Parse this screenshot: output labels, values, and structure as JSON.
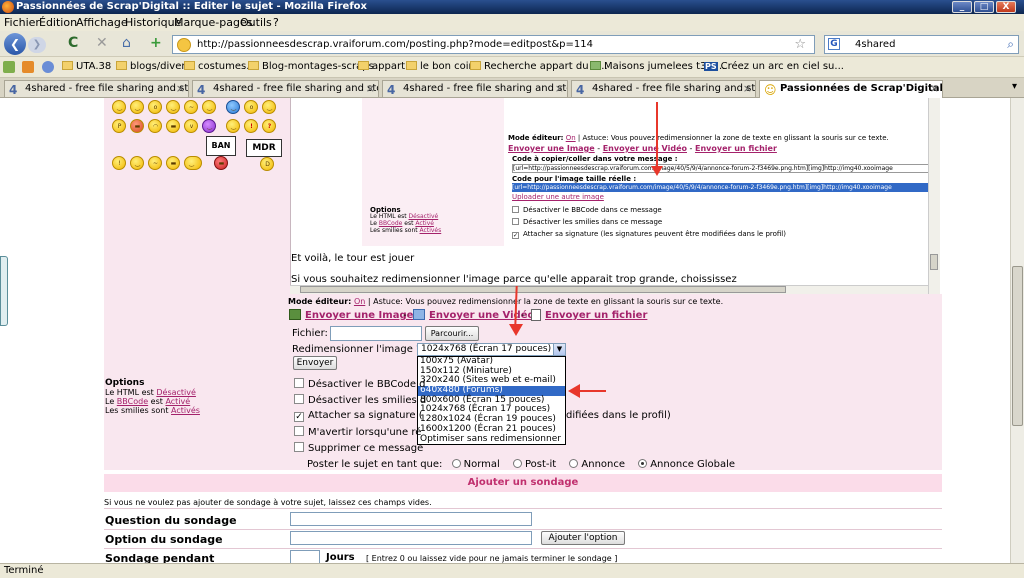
{
  "window": {
    "title": "Passionnées de Scrap'Digital :: Editer le sujet - Mozilla Firefox",
    "min": "_",
    "max": "□",
    "close": "X"
  },
  "menu": [
    "Fichier",
    "Édition",
    "Affichage",
    "Historique",
    "Marque-pages",
    "Outils",
    "?"
  ],
  "nav": {
    "url": "http://passionneesdescrap.vraiforum.com/posting.php?mode=editpost&p=114",
    "search": "4shared",
    "search_engine": "G",
    "back_glyph": "❮",
    "forward_glyph": "❯",
    "reload_glyph": "C",
    "stop_glyph": "✕",
    "home_glyph": "⌂",
    "add_glyph": "+",
    "star_glyph": "☆",
    "go_glyph": "⌕"
  },
  "bookmarks": [
    "UTA.38",
    "blogs/divers",
    "costumes...",
    "Blog-montages-scraps",
    "appart",
    "le bon coin",
    "Recherche appart du 2...",
    "Maisons jumelees t3 n...",
    "Créez un arc en ciel su..."
  ],
  "bookmark_ps_badge": "PS",
  "tabs": [
    {
      "label": "4shared - free file sharing and stora...",
      "icon": "4"
    },
    {
      "label": "4shared - free file sharing and stora...",
      "icon": "4"
    },
    {
      "label": "4shared - free file sharing and stora...",
      "icon": "4"
    },
    {
      "label": "4shared - free file sharing and stora...",
      "icon": "4"
    },
    {
      "label": "Passionnées de Scrap'Digital :: Edi...",
      "icon": "☺"
    }
  ],
  "tab_close": "×",
  "tab_list_glyph": "▾",
  "emote_signs": {
    "ban": "BAN",
    "mdr": "MDR"
  },
  "editor_preview": {
    "mode_label": "Mode éditeur:",
    "mode_on": "On",
    "astuce": "| Astuce: Vous pouvez redimensionner la zone de texte en glissant la souris sur ce texte.",
    "send_image": "Envoyer une Image",
    "send_video": "Envoyer une Vidéo",
    "send_file": "Envoyer un fichier",
    "code_copy_label": "Code à copier/coller dans votre message :",
    "code_copy_value": "[url=http://passionneesdescrap.vraiforum.com/image/40/5/9/4/annonce-forum-2-f3469e.png.htm][img]http://img40.xooimage",
    "code_real_label": "Code pour l'image taille réelle :",
    "code_real_value": "[url=http://passionneesdescrap.vraiforum.com/image/40/5/9/4/annonce-forum-2-f3469e.png.htm][img]http://img40.xooimage",
    "upload_other": "Uploader une autre image",
    "options_title": "Options",
    "html_line": "Le HTML est",
    "html_state": "Désactivé",
    "bbcode_word": "BBCode",
    "bbcode_line": "est",
    "bbcode_state": "Activé",
    "smilies_line": "Les smilies sont",
    "smilies_state": "Activés",
    "le": "Le",
    "cb1": "Désactiver le BBCode dans ce message",
    "cb2": "Désactiver les smilies dans ce message",
    "cb3": "Attacher sa signature (les signatures peuvent être modifiées dans le profil)"
  },
  "textarea": {
    "line1": "Et voilà, le tour est jouer",
    "line2": "Si vous souhaitez redimensionner l'image parce qu'elle apparait trop grande, choississez"
  },
  "editor": {
    "mode_label": "Mode éditeur:",
    "mode_on": "On",
    "astuce": "| Astuce: Vous pouvez redimensionner la zone de texte en glissant la souris sur ce texte.",
    "send_image": "Envoyer une Image",
    "send_video": "Envoyer une Vidéo",
    "send_file": "Envoyer un fichier",
    "dash": "-",
    "file_label": "Fichier:",
    "browse": "Parcourir...",
    "resize_label": "Redimensionner l'image ?",
    "resize_selected": "1024x768 (Écran 17 pouces)",
    "resize_options": [
      "100x75 (Avatar)",
      "150x112 (Miniature)",
      "320x240 (Sites web et e-mail)",
      "640x480 (Forums)",
      "800x600 (Écran 15 pouces)",
      "1024x768 (Écran 17 pouces)",
      "1280x1024 (Écran 19 pouces)",
      "1600x1200 (Écran 21 pouces)",
      "Optimiser sans redimensionner"
    ],
    "highlighted_option": "640x480 (Forums)",
    "send": "Envoyer"
  },
  "options": {
    "title": "Options",
    "le": "Le",
    "html_line": "Le HTML est",
    "html_state": "Désactivé",
    "bbcode_word": "BBCode",
    "bbcode_line": "est",
    "bbcode_state": "Activé",
    "smilies_line": "Les smilies sont",
    "smilies_state": "Activés",
    "cb1": "Désactiver le BBCode d",
    "cb2": "Désactiver les smilies d",
    "cb3_a": "Attacher sa signature (",
    "cb3_b": "difiées dans le profil)",
    "cb4": "M'avertir lorsqu'une ré",
    "cb5": "Supprimer ce message",
    "checkmark": "✓",
    "post_as": "Poster le sujet en tant que:",
    "post_types": [
      "Normal",
      "Post-it",
      "Annonce",
      "Annonce Globale"
    ],
    "post_selected": "Annonce Globale"
  },
  "poll": {
    "header": "Ajouter un sondage",
    "hint": "Si vous ne voulez pas ajouter de sondage à votre sujet, laissez ces champs vides.",
    "question_label": "Question du sondage",
    "option_label": "Option du sondage",
    "add_option": "Ajouter l'option",
    "duration_label": "Sondage pendant",
    "days": "Jours",
    "duration_hint": "[ Entrez 0 ou laissez vide pour ne jamais terminer le sondage ]"
  },
  "status": "Terminé",
  "colors": {
    "link": "#a4226b",
    "pink_band": "#f9e7ef",
    "annotation_red": "#e8372b",
    "selection": "#3169c6"
  }
}
